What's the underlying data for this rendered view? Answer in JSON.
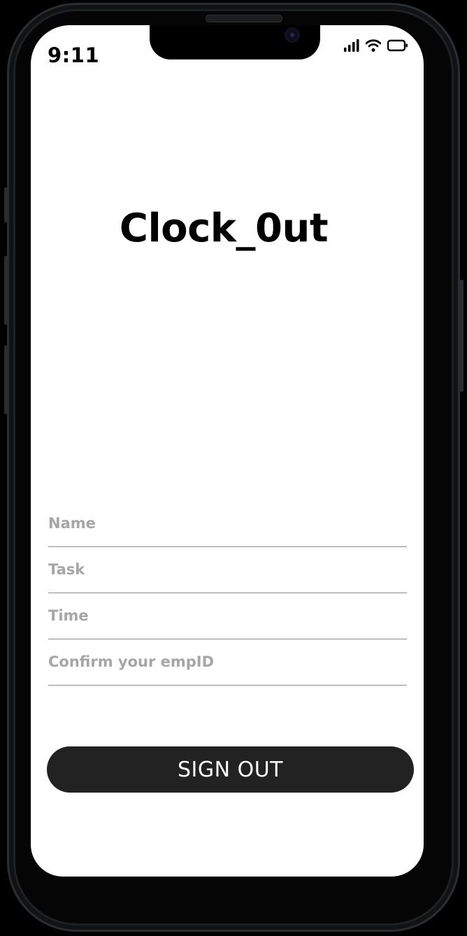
{
  "status_bar": {
    "time": "9:11",
    "icons": [
      "cellular-signal-icon",
      "wifi-icon",
      "battery-icon"
    ]
  },
  "app": {
    "title": "Clock_0ut"
  },
  "form": {
    "fields": [
      {
        "name": "name-field",
        "placeholder": "Name",
        "value": ""
      },
      {
        "name": "task-field",
        "placeholder": "Task",
        "value": ""
      },
      {
        "name": "time-field",
        "placeholder": "Time",
        "value": ""
      },
      {
        "name": "empid-field",
        "placeholder": "Confirm your empID",
        "value": ""
      }
    ],
    "submit_label": "SIGN OUT"
  },
  "colors": {
    "button_bg": "#222222",
    "placeholder": "#a6a6a6",
    "underline": "#8a8a8a"
  }
}
